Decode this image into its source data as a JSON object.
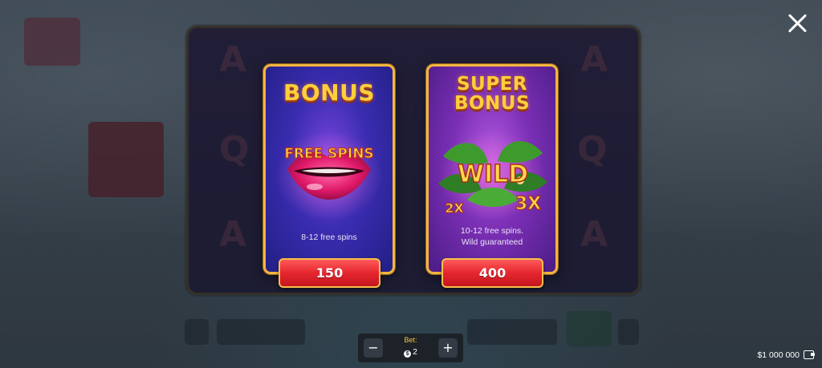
{
  "close_label": "×",
  "background": {
    "reel_letters": [
      "A",
      "Q",
      "A",
      "A",
      "Q",
      "A"
    ]
  },
  "cards": [
    {
      "title": "BONUS",
      "art_text": "FREE SPINS",
      "description": "8-12 free spins",
      "price": "150"
    },
    {
      "title_line1": "SUPER",
      "title_line2": "BONUS",
      "art_text": "WILD",
      "multiplier_left": "2X",
      "multiplier_right": "3X",
      "description_line1": "10-12 free spins.",
      "description_line2": "Wild guaranteed",
      "price": "400"
    }
  ],
  "bet": {
    "label": "Bet:",
    "coin_symbol": "$",
    "value": "2",
    "minus": "−",
    "plus": "+"
  },
  "balance": "$1 000 000",
  "colors": {
    "gold": "#ffcf3a",
    "button_red": "#e5262f",
    "bonus_card": "#2f27a0",
    "super_card": "#6a2aa8"
  },
  "icons": [
    "close-icon",
    "minus-icon",
    "plus-icon",
    "coin-icon",
    "wallet-icon"
  ]
}
